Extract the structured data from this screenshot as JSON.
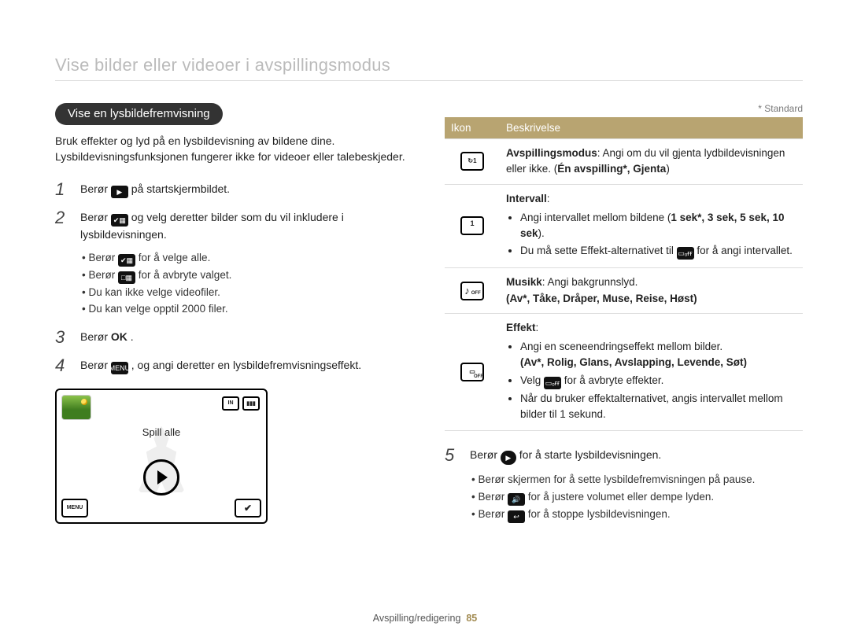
{
  "page_title": "Vise bilder eller videoer i avspillingsmodus",
  "section_title": "Vise en lysbildefremvisning",
  "intro": "Bruk effekter og lyd på en lysbildevisning av bildene dine. Lysbildevisningsfunksjonen fungerer ikke for videoer eller talebeskjeder.",
  "steps": {
    "s1": {
      "num": "1",
      "before": "Berør ",
      "after": " på startskjermbildet."
    },
    "s2": {
      "num": "2",
      "before": "Berør ",
      "after": " og velg deretter bilder som du vil inkludere i lysbildevisningen.",
      "bullets": {
        "b1_pre": "Berør ",
        "b1_post": " for å velge alle.",
        "b2_pre": "Berør ",
        "b2_post": " for å avbryte valget.",
        "b3": "Du kan ikke velge videofiler.",
        "b4": "Du kan velge opptil 2000 filer."
      }
    },
    "s3": {
      "num": "3",
      "before": "Berør ",
      "ok": "OK",
      "after": "."
    },
    "s4": {
      "num": "4",
      "before": "Berør ",
      "menu": "MENU",
      "after": ", og angi deretter en lysbildefremvisningseffekt."
    },
    "s5": {
      "num": "5",
      "before": "Berør ",
      "after": " for å starte lysbildevisningen.",
      "bullets": {
        "b1": "Berør skjermen for å sette lysbildefremvisningen på pause.",
        "b2_pre": "Berør ",
        "b2_post": " for å justere volumet eller dempe lyden.",
        "b3_pre": "Berør ",
        "b3_post": " for å stoppe lysbildevisningen."
      }
    }
  },
  "preview": {
    "caption": "Spill alle",
    "menu": "MENU",
    "select": "✔",
    "in_badge": "IN"
  },
  "standard_note": "* Standard",
  "table": {
    "h1": "Ikon",
    "h2": "Beskrivelse",
    "r1": {
      "title": "Avspillingsmodus",
      "rest": ": Angi om du vil gjenta lydbildevisningen eller ikke. (",
      "opts": "Én avspilling*, Gjenta",
      "close": ")"
    },
    "r2": {
      "title": "Intervall",
      "li1": "Angi intervallet mellom bildene (",
      "li1_opts": "1 sek*, 3 sek, 5 sek, 10 sek",
      "li1_close": ").",
      "li2_pre": "Du må sette Effekt-alternativet til ",
      "li2_post": " for å angi intervallet."
    },
    "r3": {
      "title": "Musikk",
      "rest": ": Angi bakgrunnslyd.",
      "opts": "(Av*, Tåke, Dråper, Muse, Reise, Høst)"
    },
    "r4": {
      "title": "Effekt",
      "li1": "Angi en sceneendringseffekt mellom bilder.",
      "li1_opts": "(Av*, Rolig, Glans, Avslapping, Levende, Søt)",
      "li2_pre": "Velg ",
      "li2_post": " for å avbryte effekter.",
      "li3": "Når du bruker effektalternativet, angis intervallet mellom bilder til 1 sekund."
    }
  },
  "footer": {
    "section": "Avspilling/redigering",
    "page": "85"
  }
}
